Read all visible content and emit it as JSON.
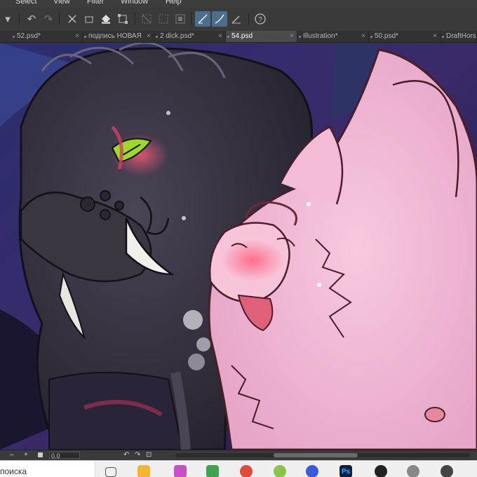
{
  "menu": [
    "Select",
    "View",
    "Filter",
    "Window",
    "Help"
  ],
  "toolbar": {
    "help_glyph": "?"
  },
  "tabs": [
    {
      "label": "52.psd*",
      "active": false
    },
    {
      "label": "подпись НОВАЯ",
      "active": false
    },
    {
      "label": "2 dick.psd*",
      "active": false
    },
    {
      "label": "54.psd",
      "active": true
    },
    {
      "label": "Illustration*",
      "active": false
    },
    {
      "label": "50.psd*",
      "active": false
    },
    {
      "label": "DraftHorse",
      "active": false
    }
  ],
  "tab_close_glyph": "×",
  "statusbar": {
    "minus": "–",
    "plus": "+",
    "zoom_value": "0.0"
  },
  "taskbar": {
    "search_text": "поиска",
    "icons": [
      {
        "name": "task-view-icon",
        "color": "#555555"
      },
      {
        "name": "file-explorer-icon",
        "color": "#f2b632"
      },
      {
        "name": "paint-app-icon",
        "color": "#c94fc9"
      },
      {
        "name": "media-app-icon",
        "color": "#3fa34d"
      },
      {
        "name": "chrome-icon",
        "color": "#e04a3b"
      },
      {
        "name": "lime-app-icon",
        "color": "#8bc34a"
      },
      {
        "name": "messenger-icon",
        "color": "#3b5bdb"
      },
      {
        "name": "photoshop-icon",
        "color": "#0b1f3a"
      },
      {
        "name": "obs-icon",
        "color": "#222222"
      },
      {
        "name": "clipstudio-icon",
        "color": "#888888"
      },
      {
        "name": "clipstudio-active-icon",
        "color": "#444444"
      }
    ],
    "ps_label": "Ps"
  }
}
